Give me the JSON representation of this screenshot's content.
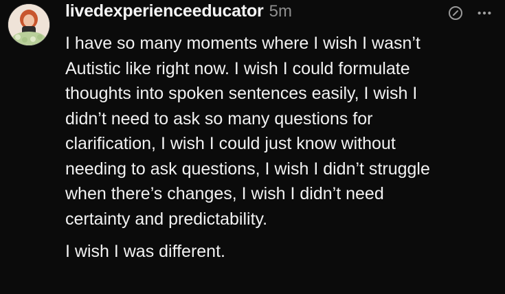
{
  "post": {
    "username": "livedexperienceeducator",
    "timestamp": "5m",
    "paragraphs": [
      "I have so many moments where I wish I wasn’t\nAutistic like right now. I wish I could formulate\nthoughts into spoken sentences easily, I wish I\ndidn’t need to ask so many questions for\nclarification, I wish I could just know without\nneeding to ask questions, I wish I didn’t struggle\nwhen there’s changes, I wish I didn’t need\ncertainty and predictability.",
      "I wish I was different."
    ]
  },
  "icons": {
    "avatar": "profile-photo",
    "edit": "pencil-circle-icon",
    "more": "more-dots-icon"
  },
  "colors": {
    "background": "#0b0b0b",
    "text": "#f2f2f2",
    "muted": "#8e8e8e"
  }
}
